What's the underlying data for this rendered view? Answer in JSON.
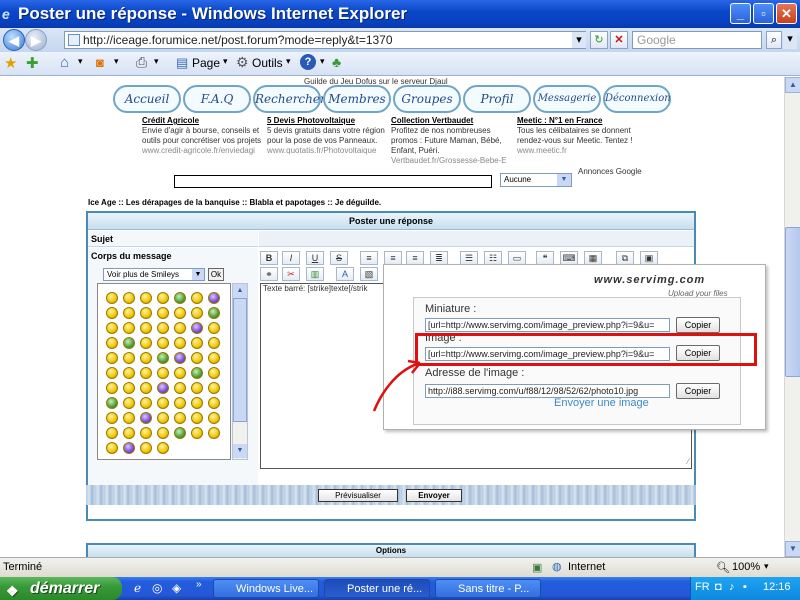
{
  "window": {
    "title": "Poster une réponse - Windows Internet Explorer"
  },
  "address_bar": {
    "url": "http://iceage.forumice.net/post.forum?mode=reply&t=1370",
    "search_placeholder": "Google"
  },
  "toolbar": {
    "page_label": "Page",
    "tools_label": "Outils"
  },
  "forum": {
    "subtitle": "Guilde du Jeu Dofus sur le serveur Djaul",
    "nav": [
      "Accueil",
      "F.A.Q",
      "Rechercher",
      "Membres",
      "Groupes",
      "Profil",
      "Messagerie",
      "Déconnexion"
    ],
    "ads": [
      {
        "title": "Crédit Agricole",
        "text": "Envie d'agir à bourse, conseils et outils pour concrétiser vos projets",
        "url": "www.credit-agricole.fr/enviedagi"
      },
      {
        "title": "5 Devis Photovoltaique",
        "text": "5 devis gratuits dans votre région pour la pose de vos Panneaux.",
        "url": "www.quotatis.fr/Photovoltaique"
      },
      {
        "title": "Collection Vertbaudet",
        "text": "Profitez de nos nombreuses promos : Future Maman, Bébé, Enfant, Puéri.",
        "url": "Vertbaudet.fr/Grossesse-Bebe-E"
      },
      {
        "title": "Meetic : N°1 en France",
        "text": "Tous les célibataires se donnent rendez-vous sur Meetic. Tentez !",
        "url": "www.meetic.fr"
      }
    ],
    "ads_by": "Annonces Google",
    "breadcrumb": "Ice Age :: Les dérapages de la banquise :: Blabla et papotages :: Je déguilde."
  },
  "form": {
    "header": "Poster une réponse",
    "subject_label": "Sujet",
    "icon_select": "Aucune",
    "body_label": "Corps du message",
    "smiley_select": "Voir plus de Smileys",
    "ok_label": "Ok",
    "editor_hint": "Texte barré: [strike]texte[/strik",
    "editor_buttons": [
      "B",
      "I",
      "U",
      "S"
    ],
    "preview_label": "Prévisualiser",
    "send_label": "Envoyer",
    "options_label": "Options"
  },
  "servimg": {
    "logo": "www.servimg.com",
    "tagline": "Upload your files",
    "thumb_label": "Miniature :",
    "thumb_value": "[url=http://www.servimg.com/image_preview.php?i=9&u=",
    "image_label": "Image :",
    "image_value": "[url=http://www.servimg.com/image_preview.php?i=9&u=",
    "address_label": "Adresse de l'image :",
    "address_value": "http://i88.servimg.com/u/f88/12/98/52/62/photo10.jpg",
    "copy_label": "Copier",
    "send_another": "Envoyer une image"
  },
  "status": {
    "text": "Terminé",
    "zone": "Internet",
    "zoom": "100%"
  },
  "taskbar": {
    "start": "démarrer",
    "buttons": [
      "Windows Live...",
      "Poster une ré...",
      "Sans titre - P..."
    ],
    "lang": "FR",
    "clock": "12:16"
  },
  "colors": {
    "title_blue": "#0a48c8",
    "form_border": "#4a8ab8",
    "highlight_red": "#e01010",
    "servimg_link": "#3a8ac8"
  }
}
